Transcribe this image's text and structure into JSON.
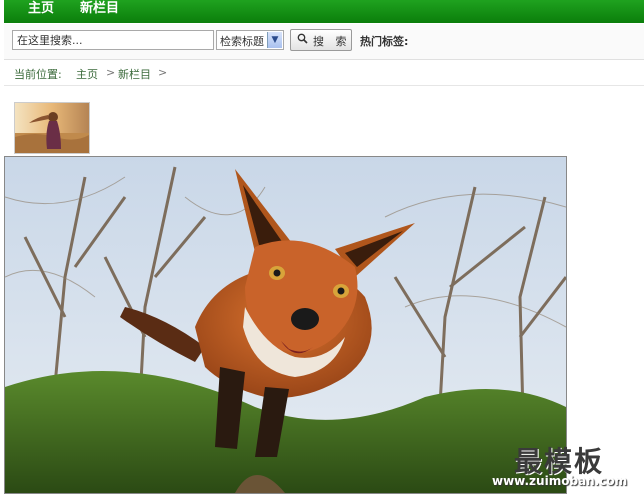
{
  "nav": {
    "items": [
      {
        "label": "主页"
      },
      {
        "label": "新栏目"
      }
    ]
  },
  "search": {
    "placeholder": "在这里搜索...",
    "scope_selected": "检索标题",
    "button_icon": "search-icon",
    "button_label": "搜 索",
    "hot_tags_label": "热门标签:"
  },
  "breadcrumb": {
    "prefix": "当前位置:",
    "items": [
      {
        "label": "主页"
      },
      {
        "label": "新栏目"
      }
    ],
    "separator": ">"
  },
  "watermark": {
    "title": "最模板",
    "url": "www.zuimoban.com"
  },
  "colors": {
    "nav_green": "#129212",
    "breadcrumb_green": "#3a6a3a"
  }
}
